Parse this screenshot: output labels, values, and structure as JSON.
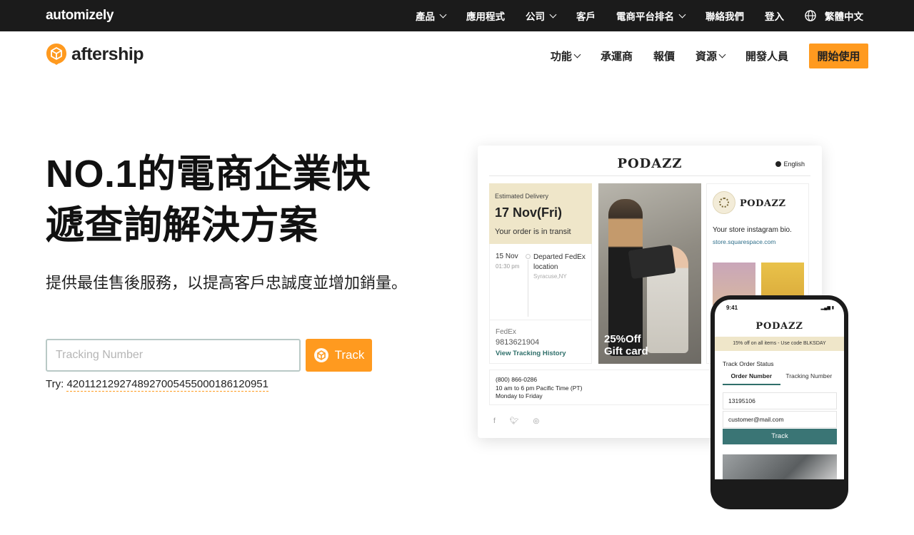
{
  "topbar": {
    "brand": "automizely",
    "items": [
      {
        "label": "產品",
        "dropdown": true
      },
      {
        "label": "應用程式",
        "dropdown": false
      },
      {
        "label": "公司",
        "dropdown": true
      },
      {
        "label": "客戶",
        "dropdown": false
      },
      {
        "label": "電商平台排名",
        "dropdown": true
      },
      {
        "label": "聯絡我們",
        "dropdown": false
      },
      {
        "label": "登入",
        "dropdown": false
      }
    ],
    "language": "繁體中文"
  },
  "header": {
    "logo_text": "aftership",
    "nav": [
      {
        "label": "功能",
        "dropdown": true
      },
      {
        "label": "承運商",
        "dropdown": false
      },
      {
        "label": "報價",
        "dropdown": false
      },
      {
        "label": "資源",
        "dropdown": true
      },
      {
        "label": "開發人員",
        "dropdown": false
      }
    ],
    "cta": "開始使用"
  },
  "hero": {
    "title_line1": "NO.1的電商企業快",
    "title_line2": "遞查詢解決方案",
    "subtitle": "提供最佳售後服務，以提高客戶忠誠度並增加銷量。",
    "input_placeholder": "Tracking Number",
    "track_button": "Track",
    "try_prefix": "Try:",
    "try_number": "420112129274892700545500018612095​1"
  },
  "mockup": {
    "store_name": "PODAZZ",
    "language": "English",
    "estimated_label": "Estimated Delivery",
    "estimated_date": "17 Nov(Fri)",
    "status": "Your order is in transit",
    "event_date": "15 Nov",
    "event_time": "01:30 pm",
    "event_desc": "Departed FedEx location",
    "event_location": "Syracuse,NY",
    "carrier": "FedEx",
    "tracking_number": "9813621904",
    "history_link": "View Tracking History",
    "promo_line1": "25%Off",
    "promo_line2": "Gift card",
    "insta_brand": "PODAZZ",
    "insta_bio": "Your store instagram bio.",
    "insta_url": "store.squarespace.com",
    "phone_number": "(800) 866-0286",
    "hours": "10 am to 6 pm Pacific Time (PT)",
    "days": "Monday to Friday",
    "social_icons": [
      "facebook-icon",
      "twitter-icon",
      "instagram-icon"
    ]
  },
  "phone": {
    "time": "9:41",
    "brand": "PODAZZ",
    "banner": "15% off on all items - Use code BLKSDAY",
    "section_title": "Track Order Status",
    "tab_order": "Order Number",
    "tab_tracking": "Tracking Number",
    "order_value": "13195106",
    "email_value": "customer@mail.com",
    "track_button": "Track"
  },
  "colors": {
    "accent": "#ff9a1f",
    "topbar_bg": "#1b1b1b",
    "teal": "#3a7575",
    "cream": "#efe6c9"
  }
}
